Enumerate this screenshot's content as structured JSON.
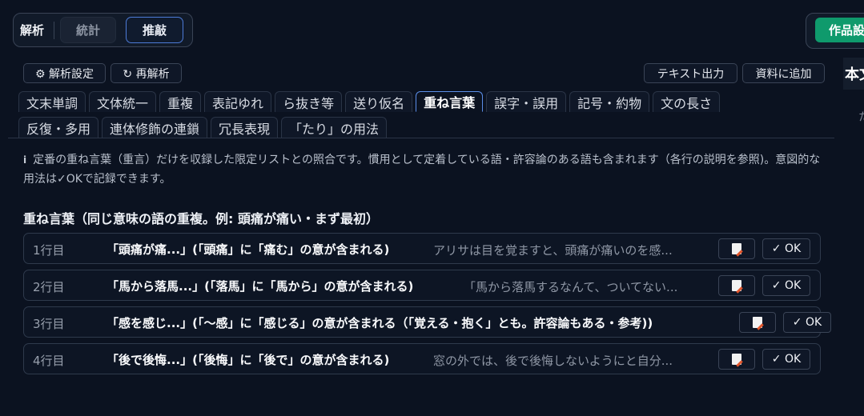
{
  "mode_bar": {
    "label": "解析",
    "stats_label": "統計",
    "edit_label": "推敲"
  },
  "header_right": {
    "button_label": "作品設",
    "side_title": "本文",
    "side_sub": "た"
  },
  "toolbar": {
    "settings_label": "⚙ 解析設定",
    "reanalyze_label": "↻ 再解析",
    "export_label": "テキスト出力",
    "add_material_label": "資料に追加"
  },
  "tabs_row1": [
    "文末単調",
    "文体統一",
    "重複",
    "表記ゆれ",
    "ら抜き等",
    "送り仮名",
    "重ね言葉",
    "誤字・誤用",
    "記号・約物",
    "文の長さ"
  ],
  "tabs_row2": [
    "反復・多用",
    "連体修飾の連鎖",
    "冗長表現",
    "「たり」の用法"
  ],
  "active_tab": "重ね言葉",
  "info": {
    "icon": "i",
    "text": "定番の重ね言葉（重言）だけを収録した限定リストとの照合です。慣用として定着している語・許容論のある語も含まれます（各行の説明を参照)。意図的な用法は✓OKで記録できます。"
  },
  "section_title": "重ね言葉（同じ意味の語の重複。例: 頭痛が痛い・まず最初）",
  "ok_label": "✓ OK",
  "rows": [
    {
      "line": "1行目",
      "desc": "「頭痛が痛...」(「頭痛」に「痛む」の意が含まれる)",
      "excerpt": "アリサは目を覚ますと、頭痛が痛いのを感..."
    },
    {
      "line": "2行目",
      "desc": "「馬から落馬...」(「落馬」に「馬から」の意が含まれる)",
      "excerpt": "「馬から落馬するなんて、ついてない..."
    },
    {
      "line": "3行目",
      "desc": "「感を感じ...」(「〜感」に「感じる」の意が含まれる（「覚える・抱く」とも。許容論もある・参考))",
      "excerpt": ""
    },
    {
      "line": "4行目",
      "desc": "「後で後悔...」(「後悔」に「後で」の意が含まれる)",
      "excerpt": "窓の外では、後で後悔しないようにと自分..."
    }
  ]
}
